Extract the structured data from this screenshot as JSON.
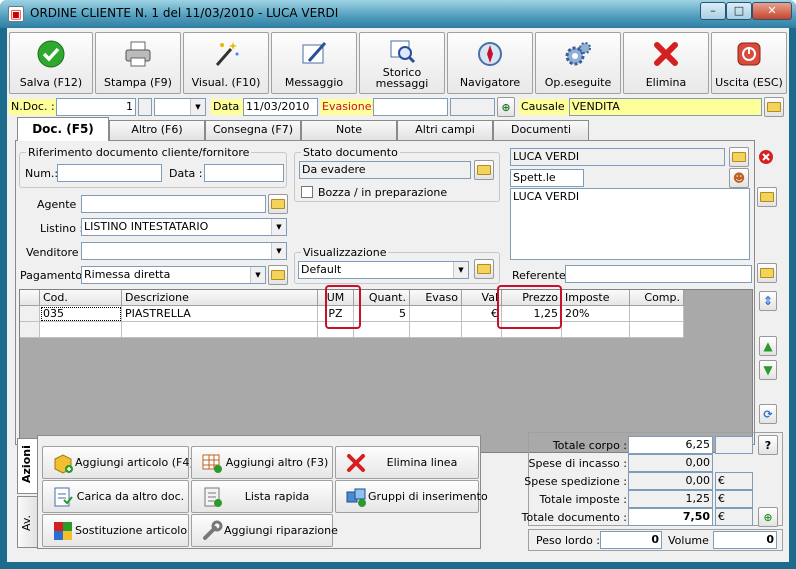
{
  "window": {
    "title": "ORDINE CLIENTE N. 1  del 11/03/2010 - LUCA VERDI",
    "min": "–",
    "max": "□",
    "close": "✕"
  },
  "toolbar": [
    {
      "label": "Salva (F12)",
      "icon": "check-icon"
    },
    {
      "label": "Stampa (F9)",
      "icon": "printer-icon"
    },
    {
      "label": "Visual. (F10)",
      "icon": "magic-wand-icon"
    },
    {
      "label": "Messaggio",
      "icon": "message-icon"
    },
    {
      "label": "Storico messaggi",
      "icon": "message-history-icon"
    },
    {
      "label": "Navigatore",
      "icon": "navigator-icon"
    },
    {
      "label": "Op.eseguite",
      "icon": "gears-icon"
    },
    {
      "label": "Elimina",
      "icon": "delete-x-icon"
    },
    {
      "label": "Uscita (ESC)",
      "icon": "exit-icon"
    }
  ],
  "header": {
    "ndoc_label": "N.Doc. :",
    "ndoc_value": "1",
    "data_label": "Data :",
    "data_value": "11/03/2010",
    "evasione_label": "Evasione:",
    "causale_label": "Causale :",
    "causale_value": "VENDITA"
  },
  "tabs": [
    "Doc. (F5)",
    "Altro (F6)",
    "Consegna (F7)",
    "Note",
    "Altri campi",
    "Documenti"
  ],
  "rif_doc": {
    "title": "Riferimento documento cliente/fornitore",
    "num_label": "Num.:",
    "data_label": "Data :"
  },
  "stato": {
    "title": "Stato documento",
    "value": "Da evadere",
    "bozza_label": "Bozza / in preparazione"
  },
  "fields": {
    "agente_label": "Agente :",
    "listino_label": "Listino :",
    "listino_value": "LISTINO INTESTATARIO",
    "venditore_label": "Venditore :",
    "pagamento_label": "Pagamento :",
    "pagamento_value": "Rimessa diretta"
  },
  "visualizzazione": {
    "title": "Visualizzazione",
    "value": "Default"
  },
  "cliente": {
    "name": "LUCA VERDI",
    "salutation": "Spett.le",
    "address": "LUCA VERDI",
    "referente_label": "Referente"
  },
  "grid": {
    "columns": [
      "Cod.",
      "Descrizione",
      "UM",
      "Quant.",
      "Evaso",
      "Val",
      "Prezzo",
      "Imposte",
      "Comp."
    ],
    "rows": [
      {
        "cod": "035",
        "descrizione": "PIASTRELLA",
        "um": "PZ",
        "quant": "5",
        "evaso": "",
        "val": "€",
        "prezzo": "1,25",
        "imposte": "20%",
        "comp": ""
      }
    ]
  },
  "side_tabs": {
    "azioni": "Azioni",
    "av": "Av."
  },
  "actions": [
    {
      "label": "Aggiungi articolo (F4)",
      "icon": "add-article-icon"
    },
    {
      "label": "Aggiungi altro (F3)",
      "icon": "add-other-icon"
    },
    {
      "label": "Elimina linea",
      "icon": "delete-line-icon"
    },
    {
      "label": "Carica da altro doc.",
      "icon": "load-doc-icon"
    },
    {
      "label": "Lista rapida",
      "icon": "quick-list-icon"
    },
    {
      "label": "Gruppi di inserimento",
      "icon": "insert-groups-icon"
    },
    {
      "label": "Sostituzione articolo",
      "icon": "replace-article-icon"
    },
    {
      "label": "Aggiungi riparazione",
      "icon": "repair-icon"
    }
  ],
  "totals": {
    "corpo_label": "Totale corpo :",
    "corpo_value": "6,25",
    "incasso_label": "Spese di incasso :",
    "incasso_value": "0,00",
    "spedizione_label": "Spese spedizione :",
    "spedizione_value": "0,00",
    "imposte_label": "Totale imposte :",
    "imposte_value": "1,25",
    "documento_label": "Totale documento :",
    "documento_value": "7,50",
    "currency": "€",
    "help": "?"
  },
  "weights": {
    "peso_label": "Peso lordo :",
    "peso_value": "0",
    "volume_label": "Volume :",
    "volume_value": "0"
  },
  "colors": {
    "accent_red": "#c8102e",
    "title_blue": "#4e9cbc",
    "yellow_label": "#ffff99"
  }
}
